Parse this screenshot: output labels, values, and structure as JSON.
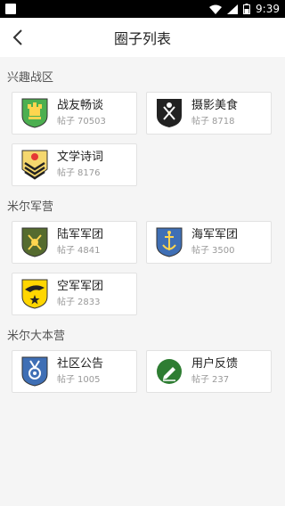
{
  "status": {
    "time": "9:39"
  },
  "header": {
    "title": "圈子列表"
  },
  "sections": [
    {
      "title": "兴趣战区",
      "items": [
        {
          "name": "战友畅谈",
          "count_label": "帖子",
          "count": "70503",
          "icon": "castle-shield-icon"
        },
        {
          "name": "摄影美食",
          "count_label": "帖子",
          "count": "8718",
          "icon": "dining-shield-icon"
        },
        {
          "name": "文学诗词",
          "count_label": "帖子",
          "count": "8176",
          "icon": "chevron-rank-icon"
        }
      ]
    },
    {
      "title": "米尔军营",
      "items": [
        {
          "name": "陆军军团",
          "count_label": "帖子",
          "count": "4841",
          "icon": "army-shield-icon"
        },
        {
          "name": "海军军团",
          "count_label": "帖子",
          "count": "3500",
          "icon": "navy-anchor-shield-icon"
        },
        {
          "name": "空军军团",
          "count_label": "帖子",
          "count": "2833",
          "icon": "air-force-eagle-shield-icon"
        }
      ]
    },
    {
      "title": "米尔大本营",
      "items": [
        {
          "name": "社区公告",
          "count_label": "帖子",
          "count": "1005",
          "icon": "medal-shield-icon"
        },
        {
          "name": "用户反馈",
          "count_label": "帖子",
          "count": "237",
          "icon": "pencil-circle-icon"
        }
      ]
    }
  ]
}
